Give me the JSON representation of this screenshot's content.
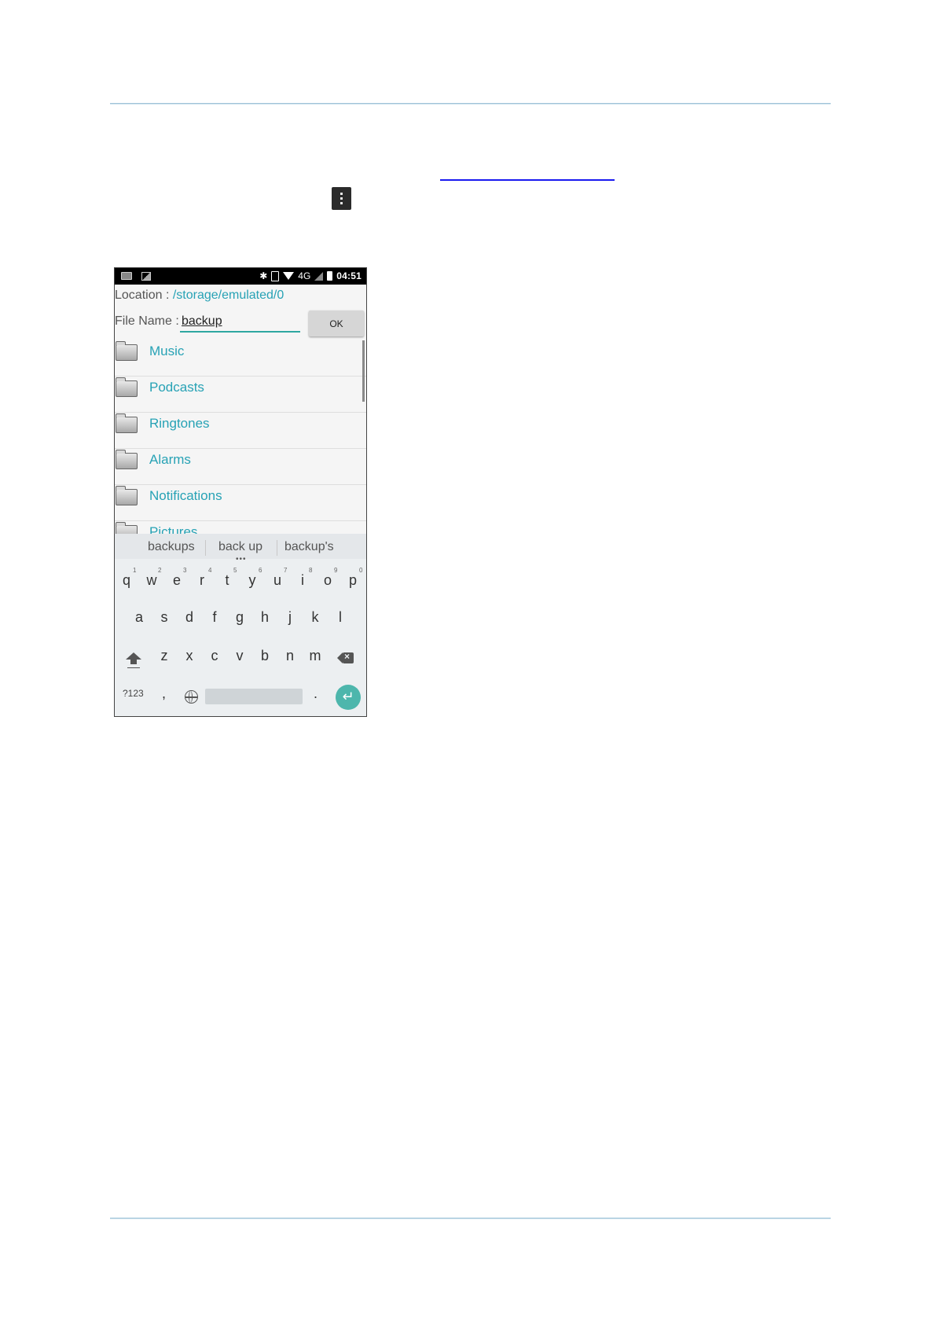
{
  "status_bar": {
    "time": "04:51",
    "network": "4G"
  },
  "dialog": {
    "location_label": "Location : ",
    "location_path": "/storage/emulated/0",
    "file_name_label": "File Name : ",
    "file_name_value": "backup",
    "ok_label": "OK"
  },
  "folders": [
    "Music",
    "Podcasts",
    "Ringtones",
    "Alarms",
    "Notifications",
    "Pictures"
  ],
  "keyboard": {
    "suggestions": [
      "backups",
      "back up",
      "backup's"
    ],
    "row1": [
      "q",
      "w",
      "e",
      "r",
      "t",
      "y",
      "u",
      "i",
      "o",
      "p"
    ],
    "row1_numbers": [
      "1",
      "2",
      "3",
      "4",
      "5",
      "6",
      "7",
      "8",
      "9",
      "0"
    ],
    "row2": [
      "a",
      "s",
      "d",
      "f",
      "g",
      "h",
      "j",
      "k",
      "l"
    ],
    "row3": [
      "z",
      "x",
      "c",
      "v",
      "b",
      "n",
      "m"
    ],
    "symbols_label": "?123",
    "comma": ",",
    "period": ".",
    "enter_symbol": "↵"
  },
  "colors": {
    "accent": "#27a2b5",
    "enter_key": "#4db6ac",
    "link_underline": "#1a1af0"
  }
}
